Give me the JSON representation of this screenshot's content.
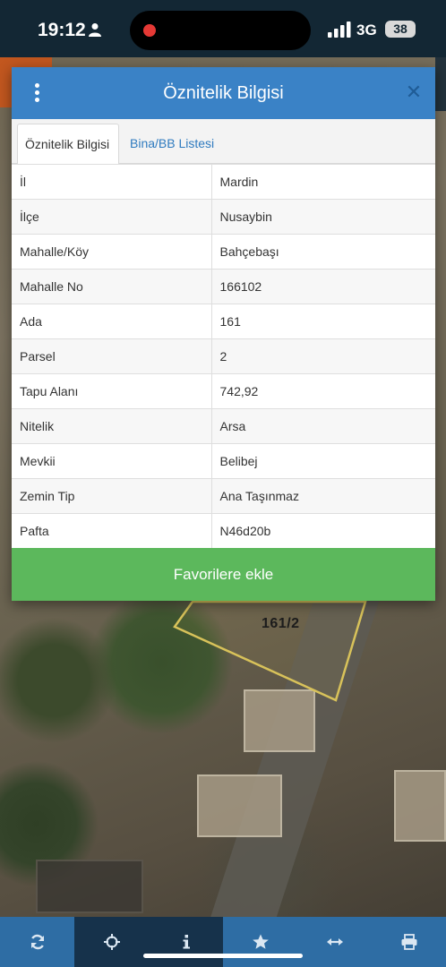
{
  "status_bar": {
    "time": "19:12",
    "network": "3G",
    "battery": "38"
  },
  "modal": {
    "title": "Öznitelik Bilgisi",
    "tabs": [
      {
        "label": "Öznitelik Bilgisi",
        "active": true
      },
      {
        "label": "Bina/BB Listesi",
        "active": false
      }
    ],
    "rows": [
      {
        "key": "İl",
        "value": "Mardin"
      },
      {
        "key": "İlçe",
        "value": "Nusaybin"
      },
      {
        "key": "Mahalle/Köy",
        "value": "Bahçebaşı"
      },
      {
        "key": "Mahalle No",
        "value": "166102"
      },
      {
        "key": "Ada",
        "value": "161"
      },
      {
        "key": "Parsel",
        "value": "2"
      },
      {
        "key": "Tapu Alanı",
        "value": "742,92"
      },
      {
        "key": "Nitelik",
        "value": "Arsa"
      },
      {
        "key": "Mevkii",
        "value": "Belibej"
      },
      {
        "key": "Zemin Tip",
        "value": "Ana Taşınmaz"
      },
      {
        "key": "Pafta",
        "value": "N46d20b"
      }
    ],
    "favorite_button": "Favorilere ekle"
  },
  "map": {
    "parcel_label": "161/2"
  },
  "toolbar": {
    "items": [
      {
        "icon": "refresh-icon",
        "active": false
      },
      {
        "icon": "crosshair-icon",
        "active": true
      },
      {
        "icon": "info-icon",
        "active": true
      },
      {
        "icon": "star-icon",
        "active": false
      },
      {
        "icon": "measure-icon",
        "active": false
      },
      {
        "icon": "print-icon",
        "active": false
      }
    ]
  },
  "colors": {
    "header": "#3a82c6",
    "tab_link": "#2f7bbf",
    "favorite": "#5cb85c",
    "toolbar": "#2e6da4",
    "toolbar_active": "#16324b",
    "parcel_outline": "#d8c25a"
  }
}
